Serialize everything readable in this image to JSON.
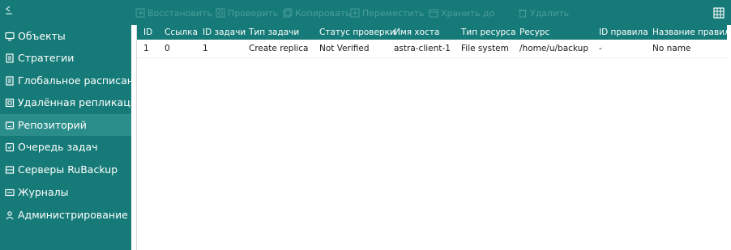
{
  "sidebar": {
    "items": [
      {
        "label": "Объекты",
        "icon": "monitor-icon"
      },
      {
        "label": "Стратегии",
        "icon": "document-icon"
      },
      {
        "label": "Глобальное расписание",
        "icon": "calendar-list-icon"
      },
      {
        "label": "Удалённая репликация",
        "icon": "replication-icon"
      },
      {
        "label": "Репозиторий",
        "icon": "repository-icon",
        "active": true
      },
      {
        "label": "Очередь задач",
        "icon": "queue-icon"
      },
      {
        "label": "Серверы RuBackup",
        "icon": "server-icon"
      },
      {
        "label": "Журналы",
        "icon": "log-icon"
      },
      {
        "label": "Администрирование",
        "icon": "admin-users-icon"
      }
    ]
  },
  "toolbar": {
    "restore": "Восстановить",
    "verify": "Проверить",
    "copy": "Копировать",
    "move": "Переместить",
    "keep_until": "Хранить до",
    "delete": "Удалить"
  },
  "table": {
    "columns": [
      "ID",
      "Ссылка",
      "ID задачи",
      "Тип задачи",
      "Статус проверки",
      "Имя хоста",
      "Тип ресурса",
      "Ресурс",
      "ID правила",
      "Название правила"
    ],
    "rows": [
      [
        "1",
        "0",
        "1",
        "Create replica",
        "Not Verified",
        "astra-client-1",
        "File system",
        "/home/u/backup",
        "-",
        "No name"
      ]
    ]
  },
  "colors": {
    "accent": "#167b78",
    "active_item": "#2a8d89",
    "disabled_toolbar_text": "#4a9c99"
  }
}
